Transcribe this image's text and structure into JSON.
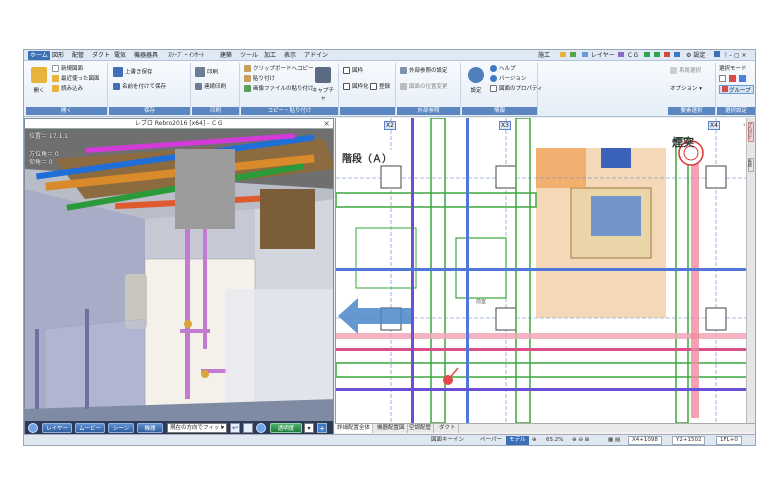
{
  "menubar": {
    "items": [
      "ホーム",
      "図形",
      "配管",
      "ダクト",
      "電気",
      "機器器具",
      "ｽﾘｰﾌﾞ・ｲﾝｻｰﾄ",
      "建築",
      "ツール",
      "加工",
      "表示",
      "アドイン"
    ],
    "right_items": [
      "施工",
      "レイヤー",
      "ＣＧ",
      "設定"
    ]
  },
  "ribbon": {
    "open_group": {
      "big_label": "開く",
      "items": [
        "新規図面",
        "最近使った図面",
        "読み込み"
      ],
      "label": "開く"
    },
    "save_group": {
      "items": [
        "上書き保存",
        "名前を付けて保存"
      ],
      "label": "保存"
    },
    "print_group": {
      "items": [
        "印刷",
        "連続印刷"
      ],
      "label": "印刷"
    },
    "copy_group": {
      "items": [
        "クリップボードへコピー",
        "貼り付け",
        "画像ファイルの貼り付け"
      ],
      "big_label": "キャプチャ",
      "label": "コピー・貼り付け"
    },
    "drawing_group": {
      "items": [
        "図枠",
        "図枠化",
        "登録"
      ]
    },
    "external_group": {
      "items": [
        "外部参照の設定",
        "図面の位置変更"
      ],
      "label": "外部参照"
    },
    "info_group": {
      "big_label": "設定",
      "items": [
        "ヘルプ",
        "バージョン",
        "図面のプロパティ"
      ],
      "label": "情報"
    },
    "right_group": {
      "items": [
        "系統選択",
        "オプション"
      ],
      "label": "要素選択"
    },
    "select_mode_group": {
      "items": [
        "選択モード",
        "グループ"
      ],
      "label": "選択設定"
    }
  },
  "viewer": {
    "title": "レブロ Rebro2016 [x64] - ＣＧ",
    "info_lines": [
      "位置＝ 17.1.1",
      "方位角＝ 0",
      "仰角＝ 0"
    ],
    "toolbar": {
      "layer": "レイヤー",
      "movie": "ムービー",
      "scene": "シーン",
      "equipment": "機器",
      "fit_select": "現在の方向でフィット",
      "transparency": "透明度"
    }
  },
  "drawing": {
    "grid_labels": [
      "X2",
      "X3",
      "X4"
    ],
    "stair_label": "階段（Ａ）",
    "chimney_label": "煙突",
    "room_label": "前室"
  },
  "right_panel": {
    "labels": [
      "プロパティ",
      "系統"
    ]
  },
  "drawing_tabs": [
    "詳細配置全体",
    "機器配置図",
    "空調配管",
    "ダクト"
  ],
  "statusbar": {
    "mode": "図面キーイン",
    "paper": "ペーパー",
    "model": "モデル",
    "zoom": "65.2%",
    "x": "X4+1098",
    "y": "Y2+1502",
    "floor": "1FL+0"
  },
  "colors": {
    "ribbon_group_label": "#5b86c0",
    "active_menu": "#3d6fb6",
    "viewer_toolbar": "#2c3a57",
    "arrow": "#4a86c8"
  }
}
